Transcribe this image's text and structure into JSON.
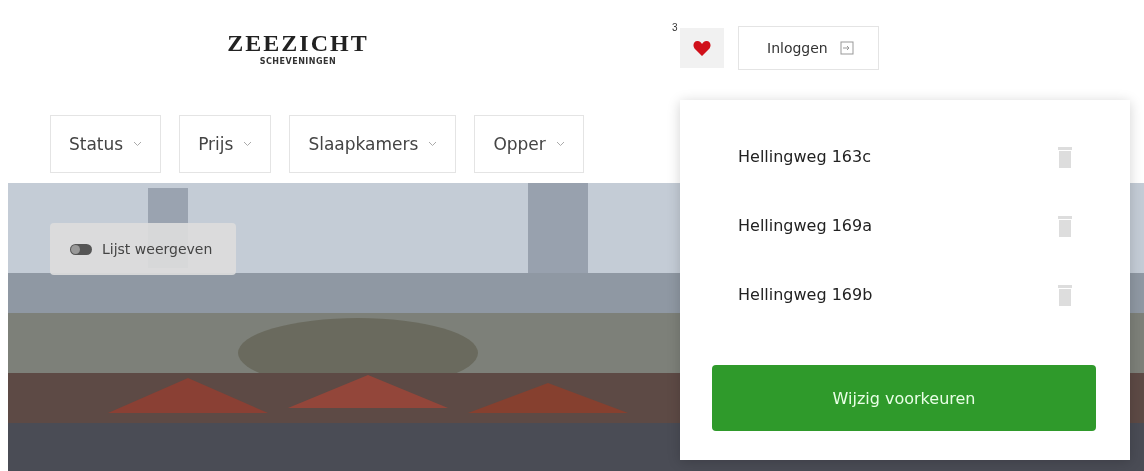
{
  "logo": {
    "name": "ZEEZICHT",
    "tagline": "SCHEVENINGEN"
  },
  "favorites": {
    "count": "3"
  },
  "login": {
    "label": "Inloggen"
  },
  "filters": [
    {
      "label": "Status"
    },
    {
      "label": "Prijs"
    },
    {
      "label": "Slaapkamers"
    },
    {
      "label": "Opper"
    }
  ],
  "view_toggle": {
    "label": "Lijst weergeven",
    "on": false
  },
  "favorites_menu": {
    "items": [
      {
        "label": "Hellingweg 163c"
      },
      {
        "label": "Hellingweg 169a"
      },
      {
        "label": "Hellingweg 169b"
      }
    ],
    "button": "Wijzig voorkeuren"
  }
}
